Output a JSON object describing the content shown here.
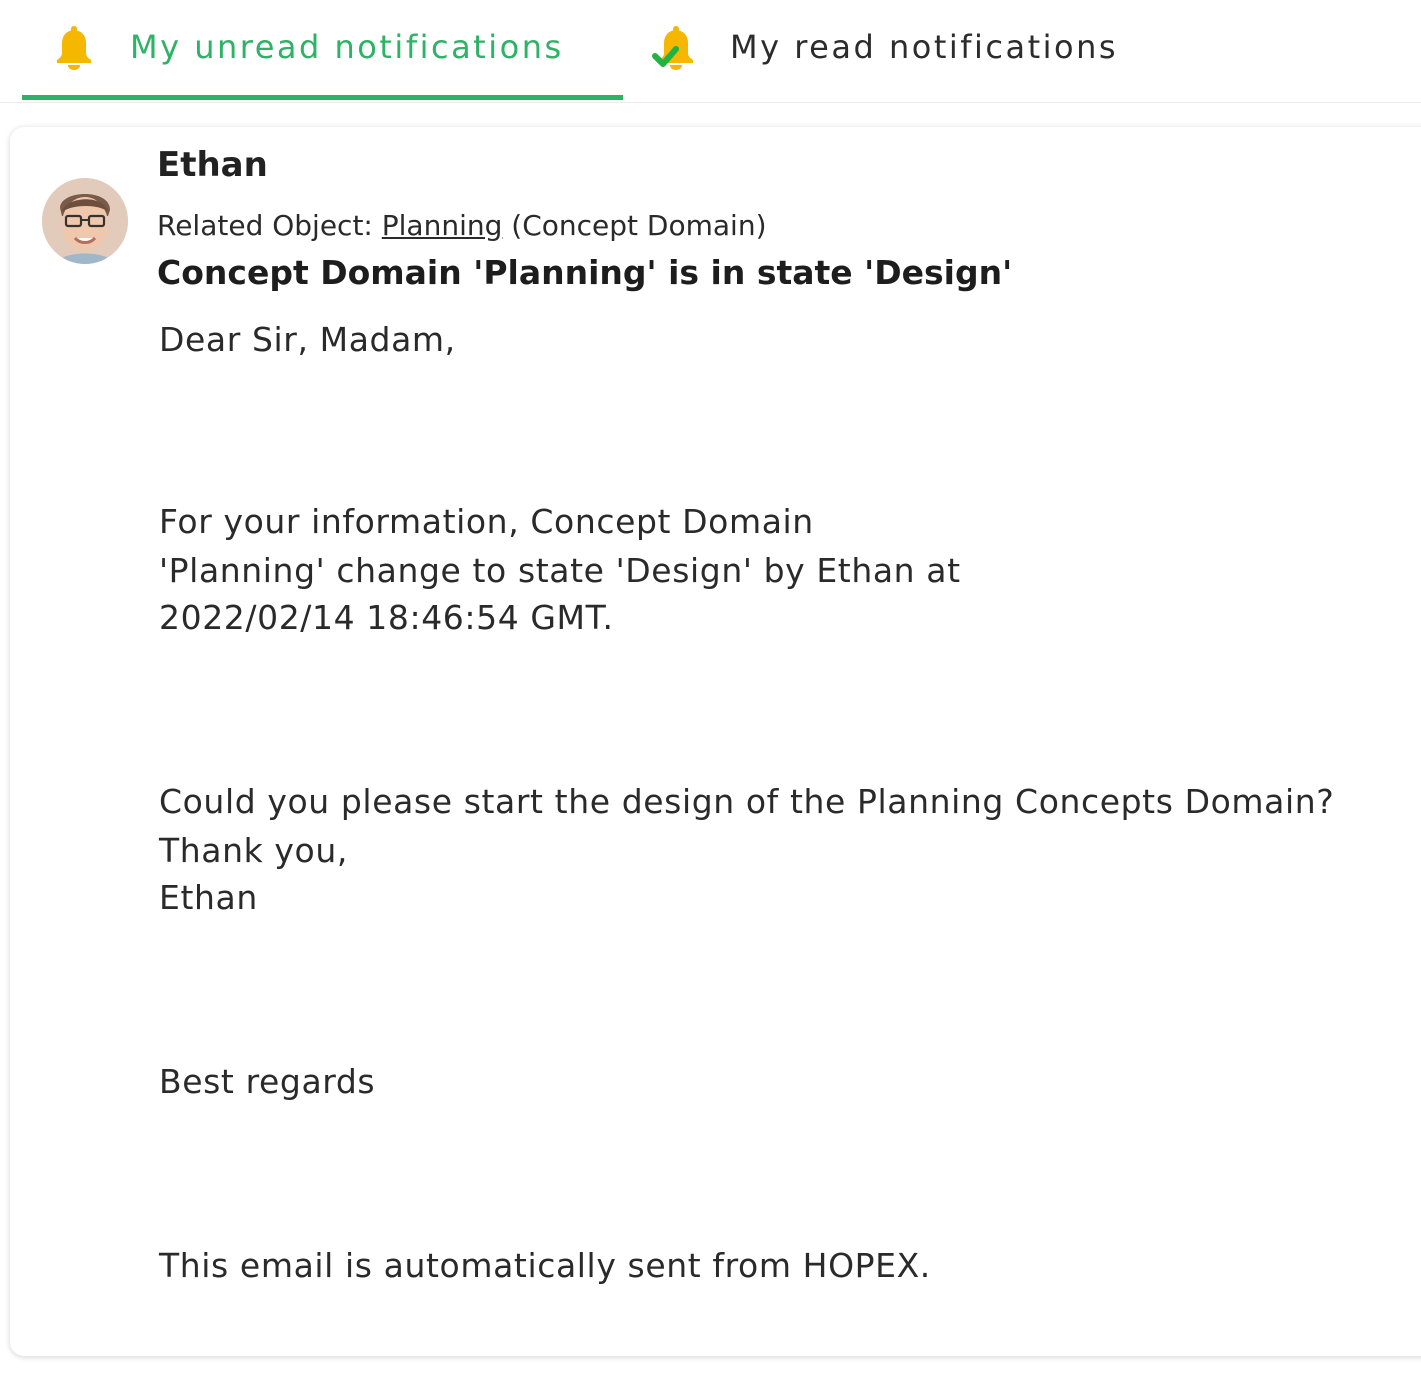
{
  "tabs": {
    "unread": {
      "label": "My unread notifications",
      "icon": "bell-icon",
      "active": true
    },
    "read": {
      "label": "My read notifications",
      "icon": "bell-check-icon",
      "active": false
    }
  },
  "colors": {
    "accent": "#2db266",
    "bell": "#f5b700",
    "check": "#1fb341"
  },
  "notification": {
    "sender": "Ethan",
    "related_prefix": "Related Object: ",
    "related_link": "Planning",
    "related_suffix": " (Concept Domain)",
    "subject": "Concept Domain 'Planning' is in state 'Design'",
    "body": {
      "greeting": "Dear Sir, Madam,",
      "info_line1": "For your information, Concept Domain",
      "info_line2": "'Planning' change to state 'Design' by Ethan at",
      "info_line3": "2022/02/14 18:46:54 GMT.",
      "request": "Could you please start the design of the Planning Concepts Domain?",
      "thanks": "Thank you,",
      "signature": "Ethan",
      "closing": "Best regards",
      "footer": "This email is automatically sent from HOPEX."
    }
  }
}
